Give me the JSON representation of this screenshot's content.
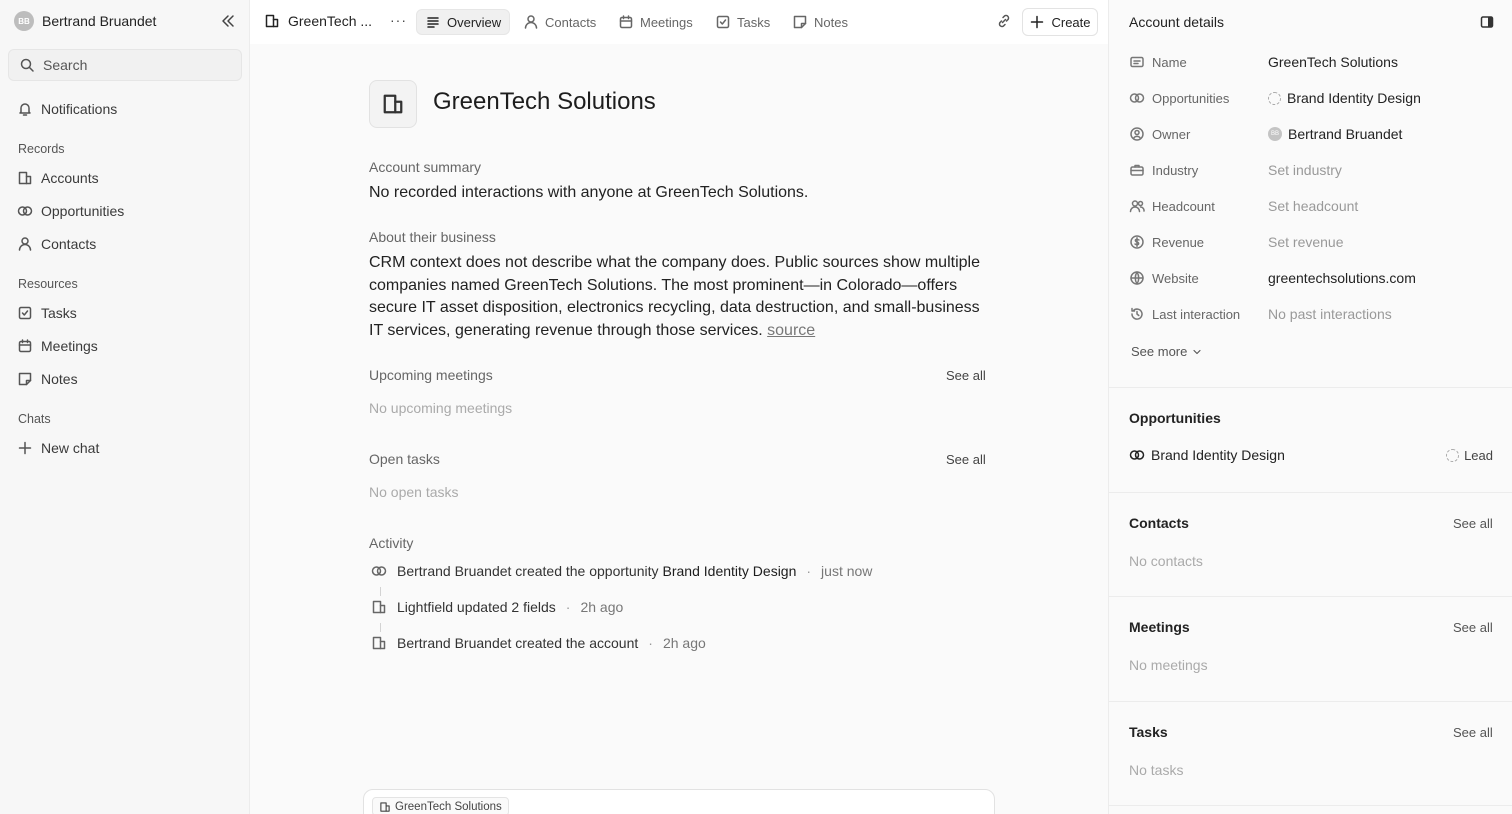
{
  "sidebar": {
    "user": {
      "initials": "BB",
      "name": "Bertrand Bruandet"
    },
    "search_placeholder": "Search",
    "notifications": "Notifications",
    "records_label": "Records",
    "records": [
      {
        "label": "Accounts",
        "icon": "building-icon"
      },
      {
        "label": "Opportunities",
        "icon": "opportunity-icon"
      },
      {
        "label": "Contacts",
        "icon": "person-icon"
      }
    ],
    "resources_label": "Resources",
    "resources": [
      {
        "label": "Tasks",
        "icon": "checkbox-icon"
      },
      {
        "label": "Meetings",
        "icon": "calendar-icon"
      },
      {
        "label": "Notes",
        "icon": "note-icon"
      }
    ],
    "chats_label": "Chats",
    "new_chat": "New chat"
  },
  "topbar": {
    "breadcrumb": "GreenTech ...",
    "more": "···",
    "tabs": [
      {
        "label": "Overview",
        "active": true
      },
      {
        "label": "Contacts",
        "active": false
      },
      {
        "label": "Meetings",
        "active": false
      },
      {
        "label": "Tasks",
        "active": false
      },
      {
        "label": "Notes",
        "active": false
      }
    ],
    "create_label": "Create"
  },
  "main": {
    "title": "GreenTech Solutions",
    "summary_label": "Account summary",
    "summary_text": "No recorded interactions with anyone at GreenTech Solutions.",
    "about_label": "About their business",
    "about_text": "CRM context does not describe what the company does. Public sources show multiple companies named GreenTech Solutions. The most prominent—in Colorado—offers secure IT asset disposition, electronics recycling, data destruction, and small-business IT services, generating revenue through those services.",
    "source_link": "source",
    "upcoming_label": "Upcoming meetings",
    "upcoming_empty": "No upcoming meetings",
    "tasks_label": "Open tasks",
    "tasks_empty": "No open tasks",
    "see_all": "See all",
    "activity_label": "Activity",
    "activity": [
      {
        "icon": "opportunity-icon",
        "text": "Bertrand Bruandet created the opportunity",
        "bold": "Brand Identity Design",
        "time": "just now"
      },
      {
        "icon": "building-icon",
        "text": "Lightfield updated 2 fields",
        "bold": "",
        "time": "2h ago"
      },
      {
        "icon": "building-icon",
        "text": "Bertrand Bruandet created the account",
        "bold": "",
        "time": "2h ago"
      }
    ],
    "chat_chip": "GreenTech Solutions"
  },
  "details": {
    "title": "Account details",
    "fields": [
      {
        "label": "Name",
        "value": "GreenTech Solutions",
        "placeholder": false
      },
      {
        "label": "Opportunities",
        "value": "Brand Identity Design",
        "placeholder": false
      },
      {
        "label": "Owner",
        "value": "Bertrand Bruandet",
        "placeholder": false,
        "initials": "BB"
      },
      {
        "label": "Industry",
        "value": "Set industry",
        "placeholder": true
      },
      {
        "label": "Headcount",
        "value": "Set headcount",
        "placeholder": true
      },
      {
        "label": "Revenue",
        "value": "Set revenue",
        "placeholder": true
      },
      {
        "label": "Website",
        "value": "greentechsolutions.com",
        "placeholder": false
      },
      {
        "label": "Last interaction",
        "value": "No past interactions",
        "placeholder": true
      }
    ],
    "see_more": "See more",
    "opportunities_title": "Opportunities",
    "opportunity": {
      "name": "Brand Identity Design",
      "stage": "Lead"
    },
    "contacts_title": "Contacts",
    "contacts_empty": "No contacts",
    "meetings_title": "Meetings",
    "meetings_empty": "No meetings",
    "tasks_title": "Tasks",
    "tasks_empty": "No tasks",
    "see_all": "See all"
  }
}
